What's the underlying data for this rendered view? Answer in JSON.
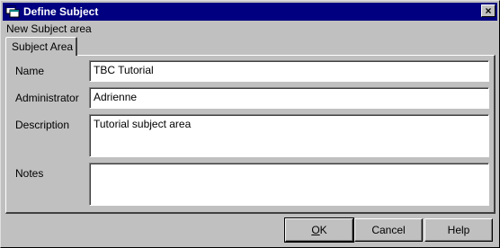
{
  "window": {
    "title": "Define Subject",
    "close_glyph": "×",
    "app_icon": "app-window-icon"
  },
  "subtitle": "New Subject area",
  "tabs": [
    {
      "label": "Subject Area",
      "active": true
    }
  ],
  "form": {
    "name_label": "Name",
    "name_value": "TBC Tutorial",
    "administrator_label": "Administrator",
    "administrator_value": "Adrienne",
    "description_label": "Description",
    "description_value": "Tutorial subject area",
    "notes_label": "Notes",
    "notes_value": ""
  },
  "buttons": {
    "ok_accel": "O",
    "ok_rest": "K",
    "cancel_label": "Cancel",
    "help_label": "Help"
  },
  "colors": {
    "titlebar": "#000080",
    "face": "#c0c0c0"
  }
}
